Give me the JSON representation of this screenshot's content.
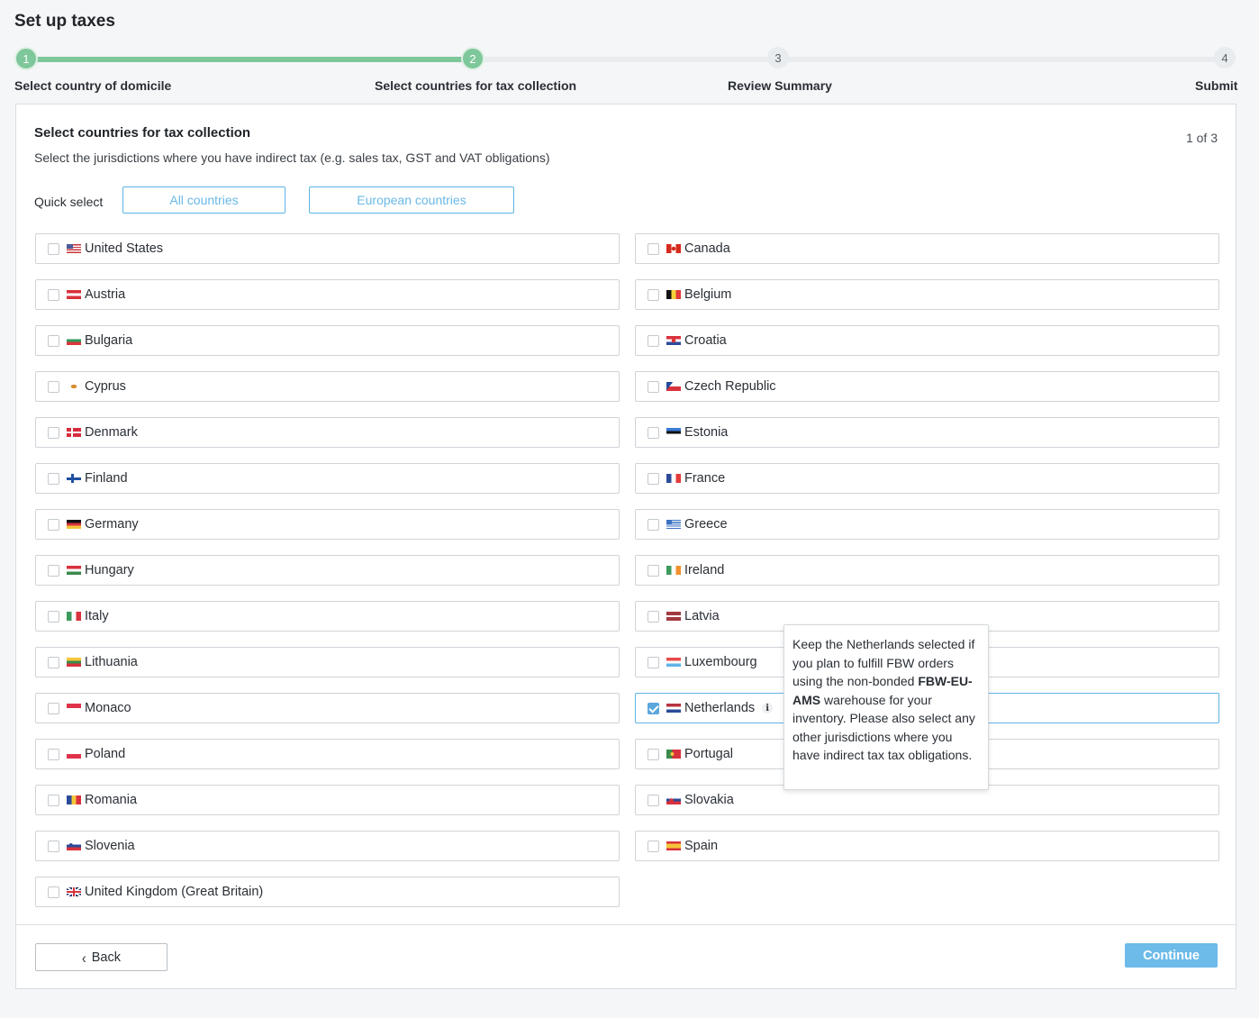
{
  "page": {
    "title": "Set up taxes"
  },
  "stepper": {
    "steps": [
      {
        "number": "1",
        "label": "Select country of domicile",
        "status": "done"
      },
      {
        "number": "2",
        "label": "Select countries for tax collection",
        "status": "current"
      },
      {
        "number": "3",
        "label": "Review Summary",
        "status": "todo"
      },
      {
        "number": "4",
        "label": "Submit",
        "status": "todo"
      }
    ],
    "colors": {
      "done": "#7ec79a",
      "todo": "#e9ecef"
    }
  },
  "section": {
    "title": "Select countries for tax collection",
    "subtitle": "Select the jurisdictions where you have indirect tax (e.g. sales tax, GST and VAT obligations)",
    "page_count": "1 of 3"
  },
  "quick_select": {
    "label": "Quick select",
    "all_label": "All countries",
    "european_label": "European countries"
  },
  "countries": [
    {
      "name": "United States",
      "flag": "us-flag-icon",
      "checked": false
    },
    {
      "name": "Canada",
      "flag": "ca-flag-icon",
      "checked": false
    },
    {
      "name": "Austria",
      "flag": "at-flag-icon",
      "checked": false
    },
    {
      "name": "Belgium",
      "flag": "be-flag-icon",
      "checked": false
    },
    {
      "name": "Bulgaria",
      "flag": "bg-flag-icon",
      "checked": false
    },
    {
      "name": "Croatia",
      "flag": "hr-flag-icon",
      "checked": false
    },
    {
      "name": "Cyprus",
      "flag": "cy-flag-icon",
      "checked": false
    },
    {
      "name": "Czech Republic",
      "flag": "cz-flag-icon",
      "checked": false
    },
    {
      "name": "Denmark",
      "flag": "dk-flag-icon",
      "checked": false
    },
    {
      "name": "Estonia",
      "flag": "ee-flag-icon",
      "checked": false
    },
    {
      "name": "Finland",
      "flag": "fi-flag-icon",
      "checked": false
    },
    {
      "name": "France",
      "flag": "fr-flag-icon",
      "checked": false
    },
    {
      "name": "Germany",
      "flag": "de-flag-icon",
      "checked": false
    },
    {
      "name": "Greece",
      "flag": "gr-flag-icon",
      "checked": false
    },
    {
      "name": "Hungary",
      "flag": "hu-flag-icon",
      "checked": false
    },
    {
      "name": "Ireland",
      "flag": "ie-flag-icon",
      "checked": false
    },
    {
      "name": "Italy",
      "flag": "it-flag-icon",
      "checked": false
    },
    {
      "name": "Latvia",
      "flag": "lv-flag-icon",
      "checked": false
    },
    {
      "name": "Lithuania",
      "flag": "lt-flag-icon",
      "checked": false
    },
    {
      "name": "Luxembourg",
      "flag": "lu-flag-icon",
      "checked": false
    },
    {
      "name": "Monaco",
      "flag": "mc-flag-icon",
      "checked": false
    },
    {
      "name": "Netherlands",
      "flag": "nl-flag-icon",
      "checked": true
    },
    {
      "name": "Poland",
      "flag": "pl-flag-icon",
      "checked": false
    },
    {
      "name": "Portugal",
      "flag": "pt-flag-icon",
      "checked": false
    },
    {
      "name": "Romania",
      "flag": "ro-flag-icon",
      "checked": false
    },
    {
      "name": "Slovakia",
      "flag": "sk-flag-icon",
      "checked": false
    },
    {
      "name": "Slovenia",
      "flag": "si-flag-icon",
      "checked": false
    },
    {
      "name": "Spain",
      "flag": "es-flag-icon",
      "checked": false
    },
    {
      "name": "United Kingdom (Great Britain)",
      "flag": "gb-flag-icon",
      "checked": false
    }
  ],
  "tooltip": {
    "part1": "Keep the Netherlands selected if you plan to fulfill FBW orders using the non-bonded ",
    "bold": "FBW-EU-AMS",
    "part2": " warehouse for your inventory. Please also select any other jurisdictions where you have indirect tax tax obligations.",
    "info_glyph": "i"
  },
  "footer": {
    "back_label": "Back",
    "continue_label": "Continue"
  },
  "colors": {
    "accent": "#5bb4e5",
    "continue_bg": "#6cbbe9",
    "step_done": "#7ec79a"
  }
}
